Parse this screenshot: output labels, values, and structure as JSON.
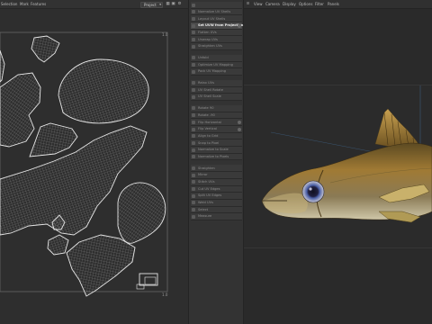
{
  "uv_editor": {
    "menu": [
      "Selection",
      "Mark",
      "Features"
    ],
    "mode_select": "Project",
    "corner_top": "1.0",
    "corner_bottom": "1.0"
  },
  "tools": [
    {
      "label": "",
      "active": false,
      "option": false,
      "sep": false
    },
    {
      "label": "Normalize UV Shells",
      "active": false,
      "option": false,
      "sep": false
    },
    {
      "label": "Layout UV Shells",
      "active": false,
      "option": false,
      "sep": false
    },
    {
      "label": "Set UVW from Projection",
      "active": true,
      "option": true,
      "sep": false
    },
    {
      "label": "Flatten UVs",
      "active": false,
      "option": false,
      "sep": false
    },
    {
      "label": "Unwrap UVs",
      "active": false,
      "option": false,
      "sep": false
    },
    {
      "label": "Straighten UVs",
      "active": false,
      "option": false,
      "sep": false
    },
    {
      "label": "Unfold",
      "active": false,
      "option": false,
      "sep": true
    },
    {
      "label": "Optimize UV Mapping",
      "active": false,
      "option": false,
      "sep": false
    },
    {
      "label": "Pack UV Mapping",
      "active": false,
      "option": false,
      "sep": false
    },
    {
      "label": "Relax UVs",
      "active": false,
      "option": false,
      "sep": true
    },
    {
      "label": "UV Shell Rotate",
      "active": false,
      "option": false,
      "sep": false
    },
    {
      "label": "UV Shell Scale",
      "active": false,
      "option": false,
      "sep": false
    },
    {
      "label": "Rotate 90",
      "active": false,
      "option": false,
      "sep": true
    },
    {
      "label": "Rotate -90",
      "active": false,
      "option": false,
      "sep": false
    },
    {
      "label": "Flip Horizontal",
      "active": false,
      "option": true,
      "sep": false
    },
    {
      "label": "Flip Vertical",
      "active": false,
      "option": true,
      "sep": false
    },
    {
      "label": "Align to Grid",
      "active": false,
      "option": false,
      "sep": false
    },
    {
      "label": "Snap to Pixel",
      "active": false,
      "option": false,
      "sep": false
    },
    {
      "label": "Normalize to Scale",
      "active": false,
      "option": false,
      "sep": false
    },
    {
      "label": "Normalize to Pixels",
      "active": false,
      "option": false,
      "sep": false
    },
    {
      "label": "Straighten",
      "active": false,
      "option": false,
      "sep": true
    },
    {
      "label": "Mirror",
      "active": false,
      "option": false,
      "sep": false
    },
    {
      "label": "Stitch UVs",
      "active": false,
      "option": false,
      "sep": false
    },
    {
      "label": "Cut UV Edges",
      "active": false,
      "option": false,
      "sep": false
    },
    {
      "label": "Split UV Edges",
      "active": false,
      "option": false,
      "sep": false
    },
    {
      "label": "Weld UVs",
      "active": false,
      "option": false,
      "sep": false
    },
    {
      "label": "Select",
      "active": false,
      "option": false,
      "sep": false
    },
    {
      "label": "Measure",
      "active": false,
      "option": false,
      "sep": false
    }
  ],
  "viewport": {
    "menu": [
      "View",
      "Camera",
      "Display",
      "Options",
      "Filter",
      "Panels"
    ]
  },
  "colors": {
    "accent": "#d9d9d9",
    "uv_wire": "#e6e6e6",
    "fish_body": "#a07a34",
    "fish_eye": "#4a5fa6"
  }
}
